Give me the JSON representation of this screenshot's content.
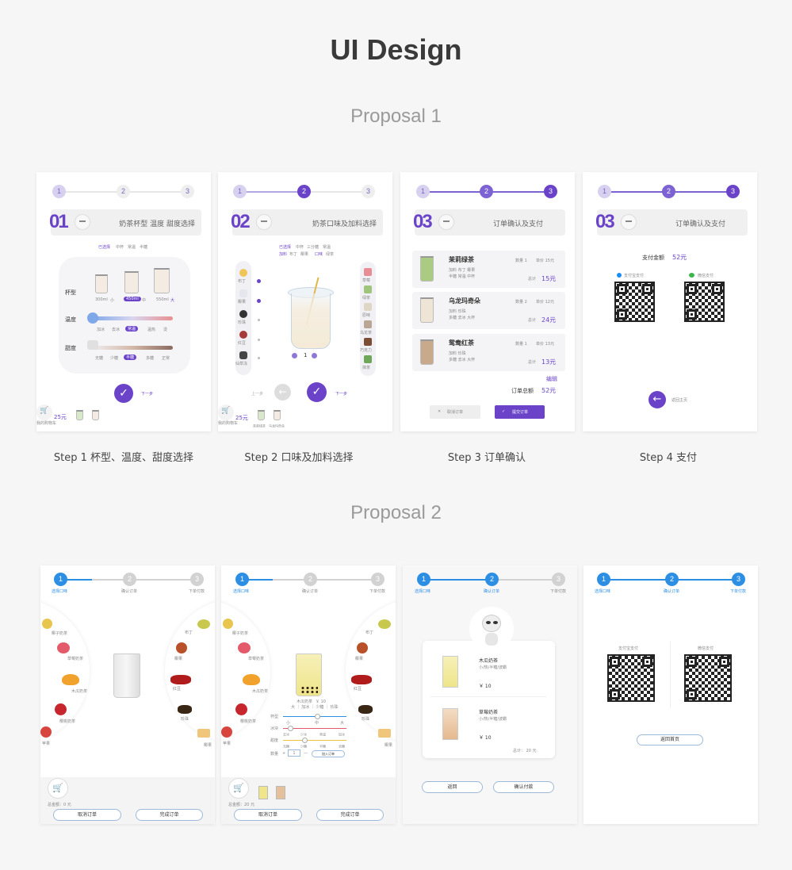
{
  "header": {
    "title": "UI Design",
    "proposal1": "Proposal 1",
    "proposal2": "Proposal 2"
  },
  "captions": [
    "Step 1  杯型、温度、甜度选择",
    "Step 2 口味及加料选择",
    "Step 3 订单确认",
    "Step 4 支付"
  ],
  "p1": {
    "steps": [
      "1",
      "2",
      "3"
    ],
    "s1": {
      "num": "01",
      "label": "奶茶杯型 温度 甜度选择",
      "chosen": "已选择",
      "chips": [
        "中杯",
        "常温",
        "半糖"
      ],
      "cup_label": "杯型",
      "temp_label": "温度",
      "sweet_label": "甜度",
      "sizes": [
        "300ml",
        "小",
        "450ml",
        "中",
        "550ml",
        "大"
      ],
      "temps": [
        "加冰",
        "去冰",
        "常温",
        "温热",
        "烫"
      ],
      "sweets": [
        "无糖",
        "少糖",
        "半糖",
        "多糖",
        "正常"
      ],
      "next": "下一步",
      "cart_label": "我的购物车",
      "cart_total": "25元"
    },
    "s2": {
      "num": "02",
      "label": "奶茶口味及加料选择",
      "chosen": "已选择",
      "chips": [
        "中杯",
        "三分糖",
        "常温"
      ],
      "addon_label": "加料",
      "addons": [
        "布丁",
        "椰果"
      ],
      "flavor_label": "口味",
      "flavor": "绿茶",
      "left_items": [
        "布丁",
        "椰果",
        "珍珠",
        "红豆",
        "仙草冻"
      ],
      "right_items": [
        "草莓",
        "绿茶",
        "原味",
        "乌龙茶",
        "巧克力",
        "抹茶"
      ],
      "count": "1",
      "prev": "上一步",
      "next": "下一步",
      "cart_label": "我的购物车",
      "cart_total": "25元",
      "cart_items": [
        "茉莉绿茶",
        "乌龙玛奇朵"
      ]
    },
    "s3": {
      "num": "03",
      "label": "订单确认及支付",
      "orders": [
        {
          "name": "茉莉绿茶",
          "qty": "数量 1",
          "unit": "单价 15元",
          "l1": "加料 布丁 椰果",
          "l2": "半糖 常温 中杯",
          "total_label": "总计",
          "total": "15元"
        },
        {
          "name": "乌龙玛奇朵",
          "qty": "数量 2",
          "unit": "单价 12元",
          "l1": "加料 珍珠",
          "l2": "多糖 去冰 大杯",
          "total_label": "总计",
          "total": "24元"
        },
        {
          "name": "鸳鸯红茶",
          "qty": "数量 1",
          "unit": "单价 13元",
          "l1": "加料 珍珠",
          "l2": "多糖 去冰 大杯",
          "total_label": "总计",
          "total": "13元"
        }
      ],
      "edit": "编辑",
      "sum_label": "订单总额",
      "sum": "52元",
      "cancel": "取消订单",
      "submit": "提交订单"
    },
    "s4": {
      "num": "03",
      "label": "订单确认及支付",
      "pay_label": "支付金额",
      "pay": "52元",
      "alipay": "支付宝支付",
      "wechat": "微信支付",
      "home": "返回主页"
    }
  },
  "p2": {
    "steps": [
      "1",
      "2",
      "3"
    ],
    "step_labels": [
      "选择口味",
      "确认订单",
      "下单付款"
    ],
    "s1": {
      "left": [
        "椰子奶茶",
        "草莓奶茶",
        "木瓜奶茶",
        "樱桃奶茶",
        "苹果"
      ],
      "right": [
        "布丁",
        "椰果",
        "红豆",
        "珍珠",
        "椰果"
      ],
      "total": "总金额：0 元",
      "cancel": "取消订单",
      "done": "完成订单"
    },
    "s2": {
      "drink": "木瓜奶茶",
      "price": "￥ 10",
      "desc": "大 ｜ 加冰 ｜ 少糖 ｜ 珍珠",
      "rows": [
        "杯型",
        "冰块",
        "甜度",
        "数量"
      ],
      "ticks1": [
        "小",
        "中",
        "大"
      ],
      "ticks2": [
        "去冰",
        "少冰",
        "常温",
        "加冰"
      ],
      "ticks3": [
        "无糖",
        "少糖",
        "半糖",
        "全糖"
      ],
      "qty": "1",
      "add": "加入订单",
      "total": "总金额：20 元",
      "cancel": "取消订单",
      "done": "完成订单"
    },
    "s3": {
      "items": [
        {
          "name": "木瓜奶茶",
          "desc": "小/热/半糖/波霸",
          "price": "￥ 10"
        },
        {
          "name": "草莓奶茶",
          "desc": "小/热/半糖/波霸",
          "price": "￥ 10"
        }
      ],
      "total": "总计：  20 元",
      "back": "返回",
      "confirm": "确认付款"
    },
    "s4": {
      "alipay": "支付宝支付",
      "wechat": "微信支付",
      "home": "返回首页"
    }
  }
}
